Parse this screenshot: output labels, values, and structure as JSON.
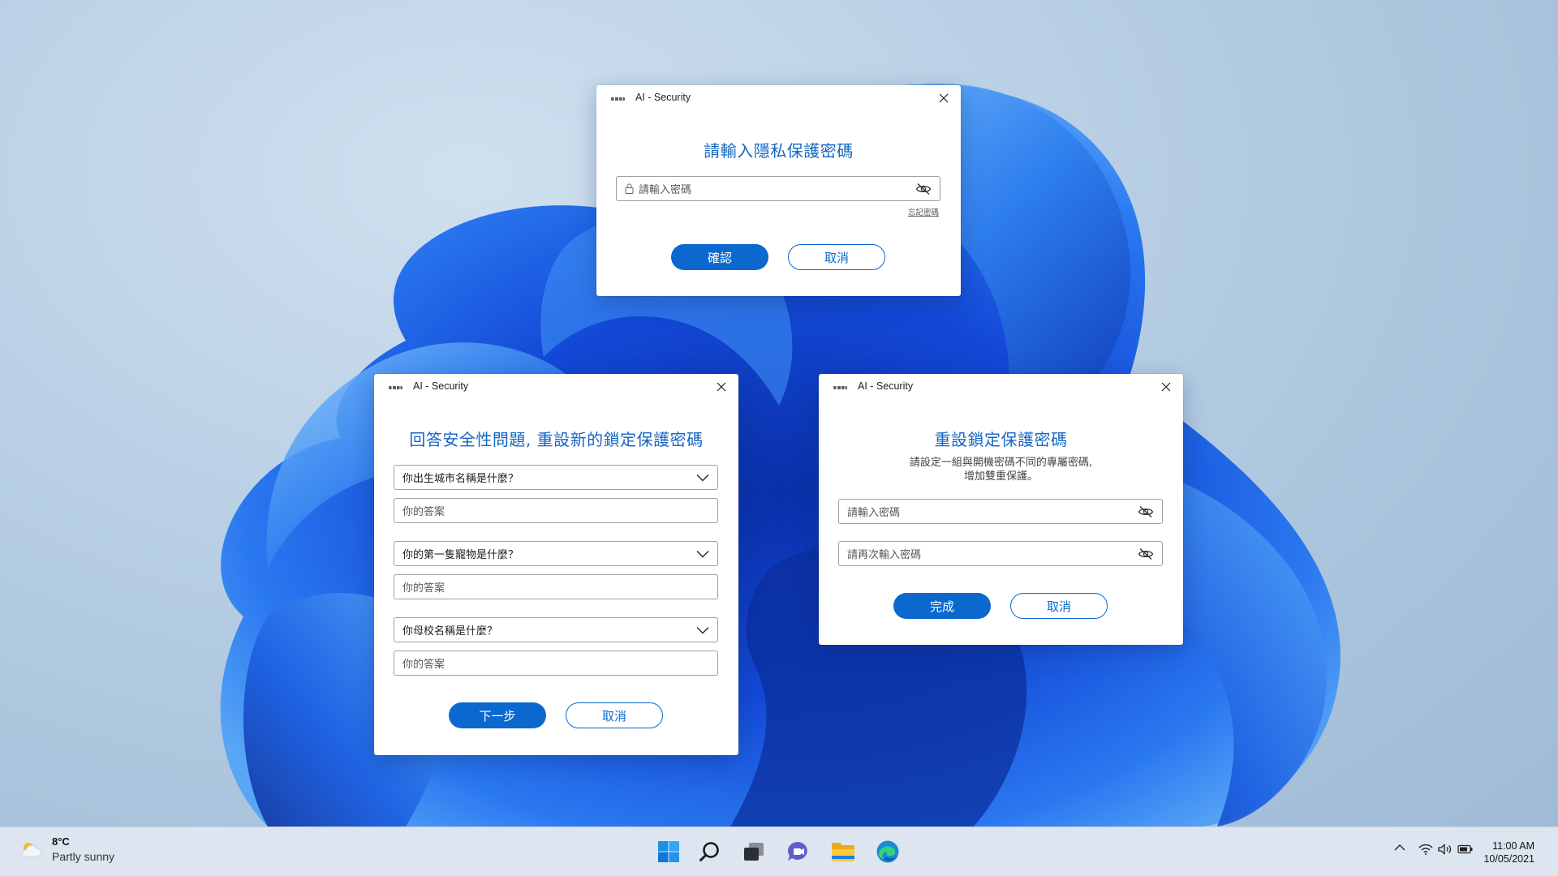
{
  "dialogs": {
    "privacy": {
      "window_title": "AI - Security",
      "heading": "請輸入隱私保護密碼",
      "password_placeholder": "請輸入密碼",
      "forgot_link": "忘記密碼",
      "confirm_label": "確認",
      "cancel_label": "取消"
    },
    "security_questions": {
      "window_title": "AI - Security",
      "heading": "回答安全性問題, 重設新的鎖定保護密碼",
      "questions": [
        {
          "question": "你出生城市名稱是什麼？",
          "answer_placeholder": "你的答案"
        },
        {
          "question": "你的第一隻寵物是什麼？",
          "answer_placeholder": "你的答案"
        },
        {
          "question": "你母校名稱是什麼？",
          "answer_placeholder": "你的答案"
        }
      ],
      "next_label": "下一步",
      "cancel_label": "取消"
    },
    "reset": {
      "window_title": "AI - Security",
      "heading": "重設鎖定保護密碼",
      "description_line1": "請設定一組與開機密碼不同的專屬密碼,",
      "description_line2": "增加雙重保護。",
      "password_placeholder": "請輸入密碼",
      "confirm_password_placeholder": "請再次輸入密碼",
      "done_label": "完成",
      "cancel_label": "取消"
    }
  },
  "taskbar": {
    "weather_temp": "8°C",
    "weather_condition": "Partly sunny",
    "pinned": [
      "windows-start-icon",
      "search-icon",
      "task-view-icon",
      "chat-icon",
      "file-explorer-icon",
      "edge-browser-icon"
    ],
    "time": "11:00 AM",
    "date": "10/05/2021"
  },
  "colors": {
    "accent": "#0a68cf",
    "heading": "#1466c4",
    "taskbar": "#dde6f0"
  }
}
